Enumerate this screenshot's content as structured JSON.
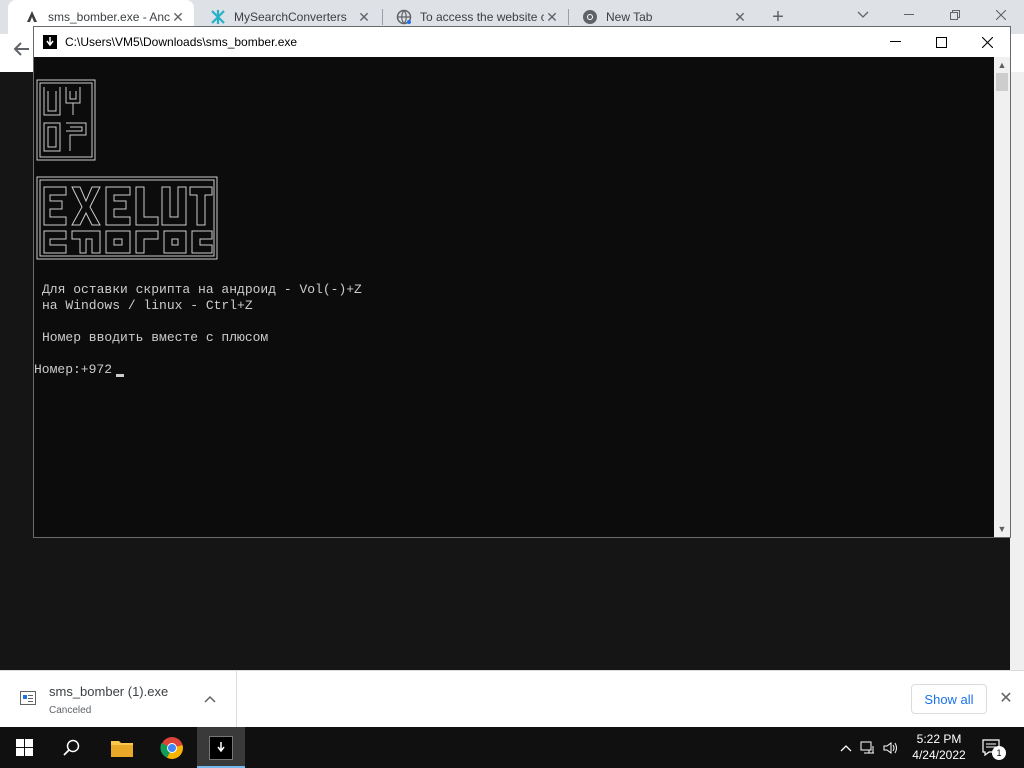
{
  "browser": {
    "tabs": [
      {
        "title": "sms_bomber.exe - Anc",
        "icon": "anyrun-icon",
        "active": true
      },
      {
        "title": "MySearchConverters",
        "icon": "mysearchconverters-icon",
        "active": false
      },
      {
        "title": "To access the website c",
        "icon": "globe-icon",
        "active": false
      },
      {
        "title": "New Tab",
        "icon": "chrome-icon",
        "active": false
      }
    ],
    "new_tab_symbol": "+"
  },
  "console": {
    "title": "C:\\Users\\VM5\\Downloads\\sms_bomber.exe",
    "lines": [
      "Для оставки скрипта на андроид - Vol(-)+Z",
      "на Windows / linux - Ctrl+Z",
      "Номер вводить вместе с плюсом",
      "Номер:+972"
    ],
    "logo_text": "BY OZ EXELUTE"
  },
  "downloads": {
    "filename": "sms_bomber (1).exe",
    "status": "Canceled",
    "show_all_label": "Show all"
  },
  "taskbar": {
    "time": "5:22 PM",
    "date": "4/24/2022",
    "notification_count": "1"
  },
  "colors": {
    "console_bg": "#0c0c0c",
    "console_text": "#cccccc",
    "accent": "#1a73e8",
    "taskbar": "#101010"
  }
}
